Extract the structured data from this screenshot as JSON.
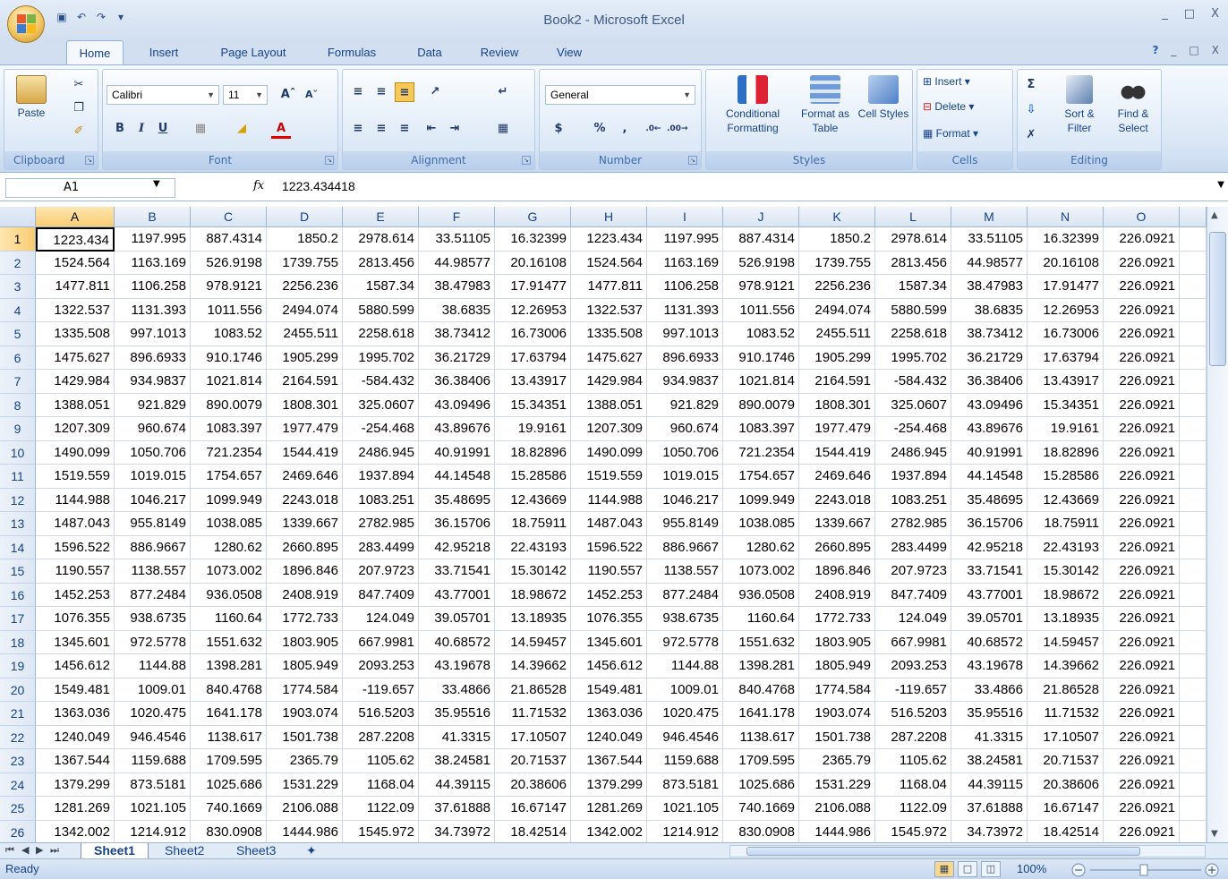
{
  "window": {
    "title": "Book2 - Microsoft Excel",
    "controls": [
      "_",
      "□",
      "X"
    ],
    "ribbon_controls": [
      "?",
      "_",
      "□",
      "X"
    ]
  },
  "qat": [
    "save-icon",
    "undo-icon",
    "redo-icon"
  ],
  "tabs": [
    "Home",
    "Insert",
    "Page Layout",
    "Formulas",
    "Data",
    "Review",
    "View"
  ],
  "ribbon": {
    "clipboard": {
      "label": "Clipboard",
      "paste": "Paste"
    },
    "font": {
      "label": "Font",
      "name": "Calibri",
      "size": "11",
      "bold": "B",
      "italic": "I",
      "underline": "U"
    },
    "alignment": {
      "label": "Alignment"
    },
    "number": {
      "label": "Number",
      "format": "General",
      "currency": "$",
      "percent": "%",
      "comma": ","
    },
    "styles": {
      "label": "Styles",
      "conditional_formatting": "Conditional Formatting",
      "format_as_table": "Format as Table",
      "cell_styles": "Cell Styles"
    },
    "cells": {
      "label": "Cells",
      "insert": "Insert",
      "delete": "Delete",
      "format": "Format"
    },
    "editing": {
      "label": "Editing",
      "sum": "Σ",
      "sort_filter": "Sort & Filter",
      "find_select": "Find & Select"
    }
  },
  "formula_bar": {
    "name_box": "A1",
    "fx": "fx",
    "formula": "1223.434418"
  },
  "columns": [
    "A",
    "B",
    "C",
    "D",
    "E",
    "F",
    "G",
    "H",
    "I",
    "J",
    "K",
    "L",
    "M",
    "N",
    "O"
  ],
  "rows": [
    [
      "1223.434",
      "1197.995",
      "887.4314",
      "1850.2",
      "2978.614",
      "33.51105",
      "16.32399",
      "1223.434",
      "1197.995",
      "887.4314",
      "1850.2",
      "2978.614",
      "33.51105",
      "16.32399",
      "226.0921"
    ],
    [
      "1524.564",
      "1163.169",
      "526.9198",
      "1739.755",
      "2813.456",
      "44.98577",
      "20.16108",
      "1524.564",
      "1163.169",
      "526.9198",
      "1739.755",
      "2813.456",
      "44.98577",
      "20.16108",
      "226.0921"
    ],
    [
      "1477.811",
      "1106.258",
      "978.9121",
      "2256.236",
      "1587.34",
      "38.47983",
      "17.91477",
      "1477.811",
      "1106.258",
      "978.9121",
      "2256.236",
      "1587.34",
      "38.47983",
      "17.91477",
      "226.0921"
    ],
    [
      "1322.537",
      "1131.393",
      "1011.556",
      "2494.074",
      "5880.599",
      "38.6835",
      "12.26953",
      "1322.537",
      "1131.393",
      "1011.556",
      "2494.074",
      "5880.599",
      "38.6835",
      "12.26953",
      "226.0921"
    ],
    [
      "1335.508",
      "997.1013",
      "1083.52",
      "2455.511",
      "2258.618",
      "38.73412",
      "16.73006",
      "1335.508",
      "997.1013",
      "1083.52",
      "2455.511",
      "2258.618",
      "38.73412",
      "16.73006",
      "226.0921"
    ],
    [
      "1475.627",
      "896.6933",
      "910.1746",
      "1905.299",
      "1995.702",
      "36.21729",
      "17.63794",
      "1475.627",
      "896.6933",
      "910.1746",
      "1905.299",
      "1995.702",
      "36.21729",
      "17.63794",
      "226.0921"
    ],
    [
      "1429.984",
      "934.9837",
      "1021.814",
      "2164.591",
      "-584.432",
      "36.38406",
      "13.43917",
      "1429.984",
      "934.9837",
      "1021.814",
      "2164.591",
      "-584.432",
      "36.38406",
      "13.43917",
      "226.0921"
    ],
    [
      "1388.051",
      "921.829",
      "890.0079",
      "1808.301",
      "325.0607",
      "43.09496",
      "15.34351",
      "1388.051",
      "921.829",
      "890.0079",
      "1808.301",
      "325.0607",
      "43.09496",
      "15.34351",
      "226.0921"
    ],
    [
      "1207.309",
      "960.674",
      "1083.397",
      "1977.479",
      "-254.468",
      "43.89676",
      "19.9161",
      "1207.309",
      "960.674",
      "1083.397",
      "1977.479",
      "-254.468",
      "43.89676",
      "19.9161",
      "226.0921"
    ],
    [
      "1490.099",
      "1050.706",
      "721.2354",
      "1544.419",
      "2486.945",
      "40.91991",
      "18.82896",
      "1490.099",
      "1050.706",
      "721.2354",
      "1544.419",
      "2486.945",
      "40.91991",
      "18.82896",
      "226.0921"
    ],
    [
      "1519.559",
      "1019.015",
      "1754.657",
      "2469.646",
      "1937.894",
      "44.14548",
      "15.28586",
      "1519.559",
      "1019.015",
      "1754.657",
      "2469.646",
      "1937.894",
      "44.14548",
      "15.28586",
      "226.0921"
    ],
    [
      "1144.988",
      "1046.217",
      "1099.949",
      "2243.018",
      "1083.251",
      "35.48695",
      "12.43669",
      "1144.988",
      "1046.217",
      "1099.949",
      "2243.018",
      "1083.251",
      "35.48695",
      "12.43669",
      "226.0921"
    ],
    [
      "1487.043",
      "955.8149",
      "1038.085",
      "1339.667",
      "2782.985",
      "36.15706",
      "18.75911",
      "1487.043",
      "955.8149",
      "1038.085",
      "1339.667",
      "2782.985",
      "36.15706",
      "18.75911",
      "226.0921"
    ],
    [
      "1596.522",
      "886.9667",
      "1280.62",
      "2660.895",
      "283.4499",
      "42.95218",
      "22.43193",
      "1596.522",
      "886.9667",
      "1280.62",
      "2660.895",
      "283.4499",
      "42.95218",
      "22.43193",
      "226.0921"
    ],
    [
      "1190.557",
      "1138.557",
      "1073.002",
      "1896.846",
      "207.9723",
      "33.71541",
      "15.30142",
      "1190.557",
      "1138.557",
      "1073.002",
      "1896.846",
      "207.9723",
      "33.71541",
      "15.30142",
      "226.0921"
    ],
    [
      "1452.253",
      "877.2484",
      "936.0508",
      "2408.919",
      "847.7409",
      "43.77001",
      "18.98672",
      "1452.253",
      "877.2484",
      "936.0508",
      "2408.919",
      "847.7409",
      "43.77001",
      "18.98672",
      "226.0921"
    ],
    [
      "1076.355",
      "938.6735",
      "1160.64",
      "1772.733",
      "124.049",
      "39.05701",
      "13.18935",
      "1076.355",
      "938.6735",
      "1160.64",
      "1772.733",
      "124.049",
      "39.05701",
      "13.18935",
      "226.0921"
    ],
    [
      "1345.601",
      "972.5778",
      "1551.632",
      "1803.905",
      "667.9981",
      "40.68572",
      "14.59457",
      "1345.601",
      "972.5778",
      "1551.632",
      "1803.905",
      "667.9981",
      "40.68572",
      "14.59457",
      "226.0921"
    ],
    [
      "1456.612",
      "1144.88",
      "1398.281",
      "1805.949",
      "2093.253",
      "43.19678",
      "14.39662",
      "1456.612",
      "1144.88",
      "1398.281",
      "1805.949",
      "2093.253",
      "43.19678",
      "14.39662",
      "226.0921"
    ],
    [
      "1549.481",
      "1009.01",
      "840.4768",
      "1774.584",
      "-119.657",
      "33.4866",
      "21.86528",
      "1549.481",
      "1009.01",
      "840.4768",
      "1774.584",
      "-119.657",
      "33.4866",
      "21.86528",
      "226.0921"
    ],
    [
      "1363.036",
      "1020.475",
      "1641.178",
      "1903.074",
      "516.5203",
      "35.95516",
      "11.71532",
      "1363.036",
      "1020.475",
      "1641.178",
      "1903.074",
      "516.5203",
      "35.95516",
      "11.71532",
      "226.0921"
    ],
    [
      "1240.049",
      "946.4546",
      "1138.617",
      "1501.738",
      "287.2208",
      "41.3315",
      "17.10507",
      "1240.049",
      "946.4546",
      "1138.617",
      "1501.738",
      "287.2208",
      "41.3315",
      "17.10507",
      "226.0921"
    ],
    [
      "1367.544",
      "1159.688",
      "1709.595",
      "2365.79",
      "1105.62",
      "38.24581",
      "20.71537",
      "1367.544",
      "1159.688",
      "1709.595",
      "2365.79",
      "1105.62",
      "38.24581",
      "20.71537",
      "226.0921"
    ],
    [
      "1379.299",
      "873.5181",
      "1025.686",
      "1531.229",
      "1168.04",
      "44.39115",
      "20.38606",
      "1379.299",
      "873.5181",
      "1025.686",
      "1531.229",
      "1168.04",
      "44.39115",
      "20.38606",
      "226.0921"
    ],
    [
      "1281.269",
      "1021.105",
      "740.1669",
      "2106.088",
      "1122.09",
      "37.61888",
      "16.67147",
      "1281.269",
      "1021.105",
      "740.1669",
      "2106.088",
      "1122.09",
      "37.61888",
      "16.67147",
      "226.0921"
    ],
    [
      "1342.002",
      "1214.912",
      "830.0908",
      "1444.986",
      "1545.972",
      "34.73972",
      "18.42514",
      "1342.002",
      "1214.912",
      "830.0908",
      "1444.986",
      "1545.972",
      "34.73972",
      "18.42514",
      "226.0921"
    ]
  ],
  "sheets": [
    "Sheet1",
    "Sheet2",
    "Sheet3"
  ],
  "status": {
    "ready": "Ready",
    "zoom": "100%"
  }
}
